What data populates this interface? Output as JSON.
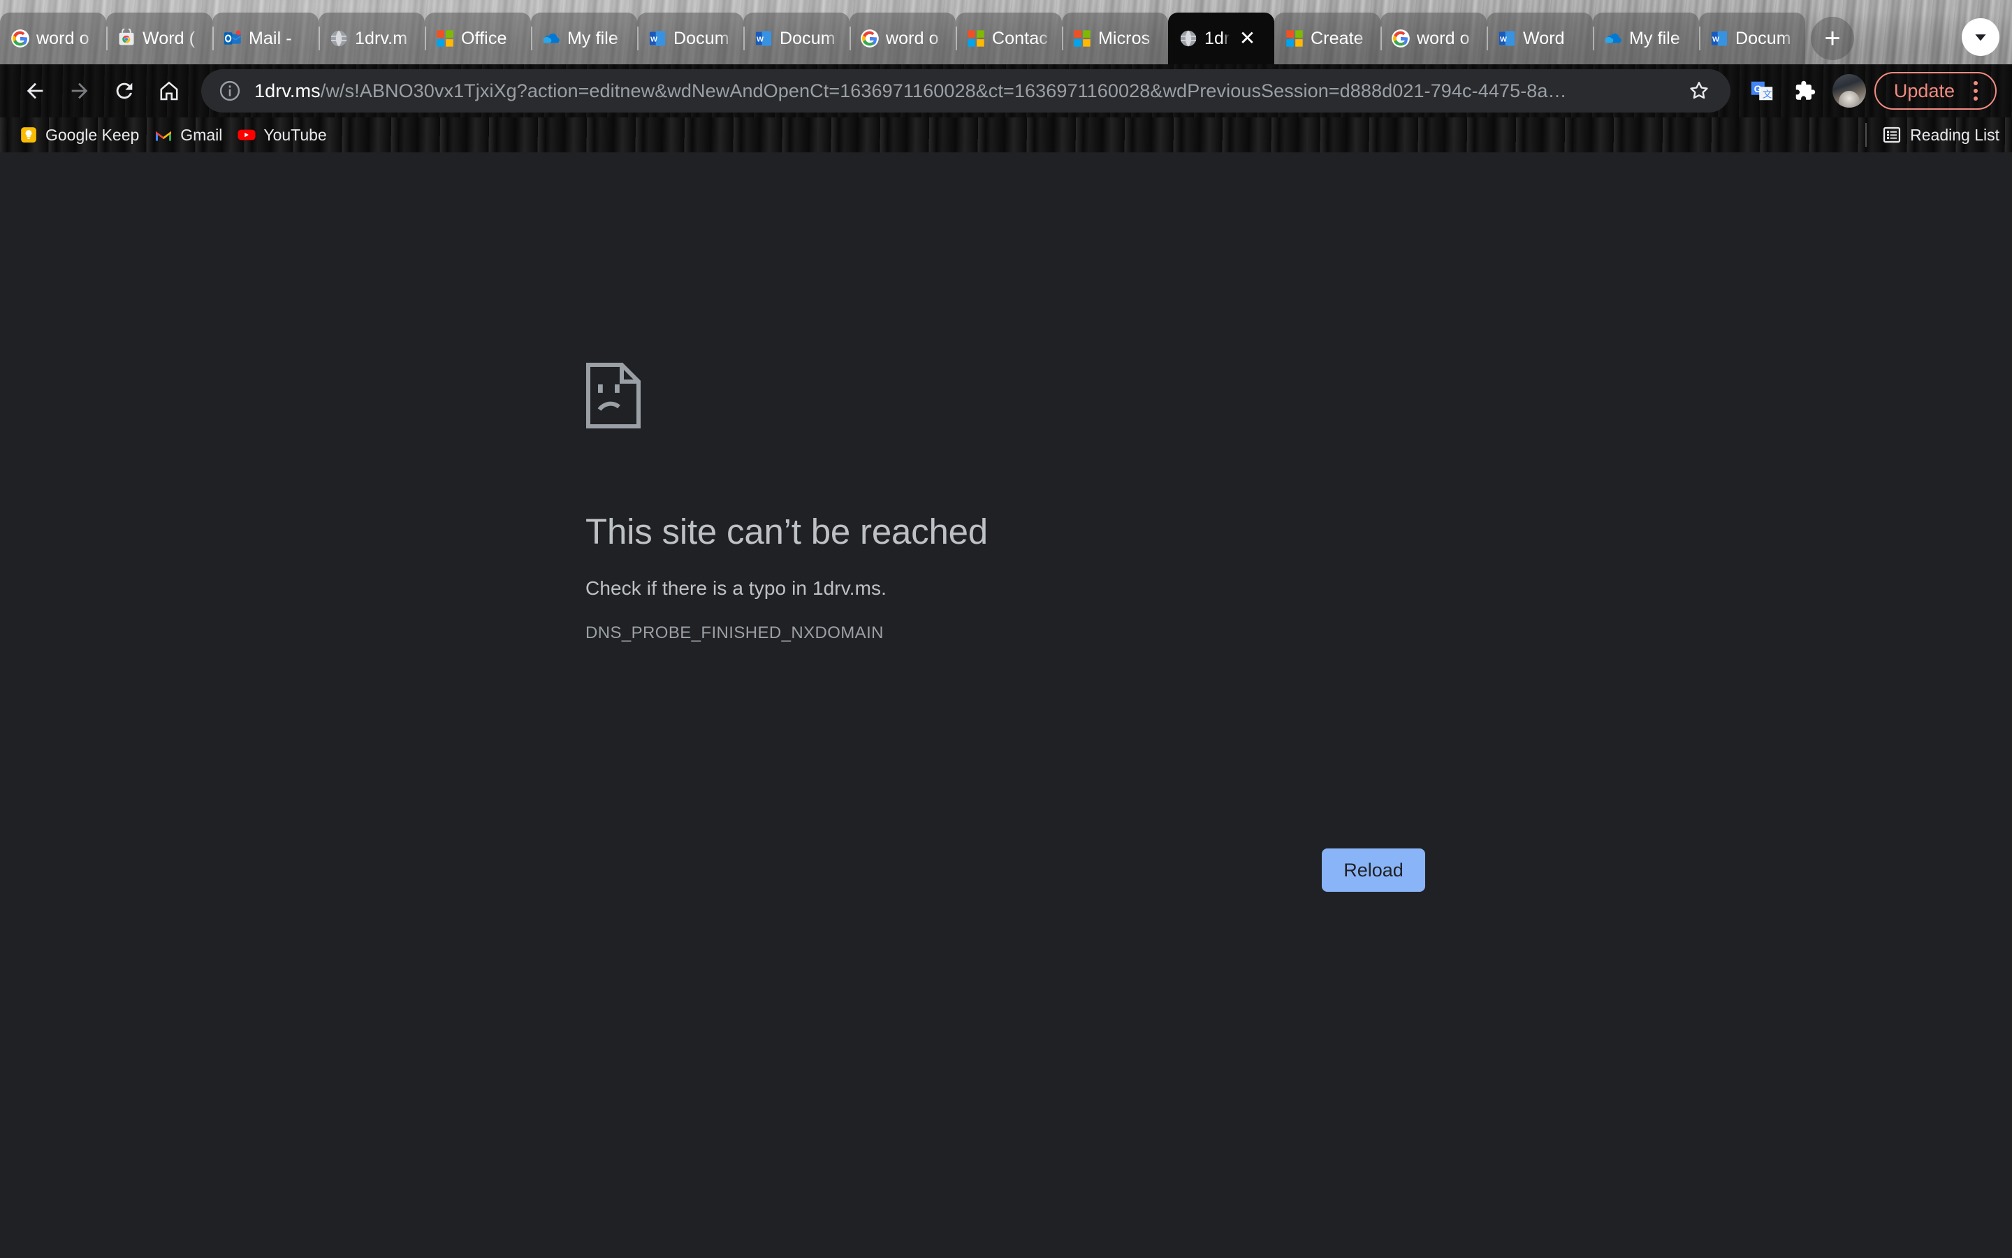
{
  "window": {
    "tabs": [
      {
        "title": "word o",
        "favicon": "google-icon",
        "active": false
      },
      {
        "title": "Word (",
        "favicon": "chrome-webstore-icon",
        "active": false
      },
      {
        "title": "Mail -",
        "favicon": "outlook-icon",
        "active": false
      },
      {
        "title": "1drv.m",
        "favicon": "globe-icon",
        "active": false
      },
      {
        "title": "Office",
        "favicon": "microsoft-icon",
        "active": false
      },
      {
        "title": "My file",
        "favicon": "onedrive-icon",
        "active": false
      },
      {
        "title": "Docum",
        "favicon": "word-icon",
        "active": false
      },
      {
        "title": "Docum",
        "favicon": "word-icon",
        "active": false
      },
      {
        "title": "word o",
        "favicon": "google-icon",
        "active": false
      },
      {
        "title": "Contac",
        "favicon": "microsoft-icon",
        "active": false
      },
      {
        "title": "Micros",
        "favicon": "microsoft-icon",
        "active": false
      },
      {
        "title": "1dr",
        "favicon": "globe-icon",
        "active": true,
        "close_label": "✕"
      },
      {
        "title": "Create",
        "favicon": "microsoft-icon",
        "active": false
      },
      {
        "title": "word o",
        "favicon": "google-icon",
        "active": false
      },
      {
        "title": "Word",
        "favicon": "word-icon",
        "active": false
      },
      {
        "title": "My file",
        "favicon": "onedrive-icon",
        "active": false
      },
      {
        "title": "Docum",
        "favicon": "word-icon",
        "active": false
      }
    ],
    "new_tab_label": "+",
    "tab_search_icon": "chevron-down-icon"
  },
  "toolbar": {
    "back_icon": "back-arrow-icon",
    "forward_icon": "forward-arrow-icon",
    "reload_icon": "reload-icon",
    "home_icon": "home-icon",
    "site_info_icon": "info-circle-icon",
    "url_host": "1drv.ms",
    "url_path": "/w/s!ABNO30vx1TjxiXg?action=editnew&wdNewAndOpenCt=1636971160028&ct=1636971160028&wdPreviousSession=d888d021-794c-4475-8a…",
    "bookmark_icon": "star-icon",
    "translate_icon": "google-translate-icon",
    "extensions_icon": "puzzle-piece-icon",
    "profile_icon": "avatar",
    "update_label": "Update",
    "menu_icon": "three-dot-menu-icon"
  },
  "bookmarks_bar": {
    "items": [
      {
        "label": "Google Keep",
        "icon": "google-keep-icon"
      },
      {
        "label": "Gmail",
        "icon": "gmail-icon"
      },
      {
        "label": "YouTube",
        "icon": "youtube-icon"
      }
    ],
    "reading_list_label": "Reading List",
    "reading_list_icon": "reading-list-icon"
  },
  "error_page": {
    "icon": "sad-page-icon",
    "heading": "This site can’t be reached",
    "detail": "Check if there is a typo in 1drv.ms.",
    "code": "DNS_PROBE_FINISHED_NXDOMAIN",
    "reload_label": "Reload"
  },
  "colors": {
    "page_background": "#202124",
    "chrome_background": "#0a0a0a",
    "omnibox_background": "#2a2b2e",
    "heading_text": "#bdc1c6",
    "reload_button": "#8ab4f8",
    "update_accent": "#f28b82",
    "active_tab": "#0b0b0b"
  }
}
